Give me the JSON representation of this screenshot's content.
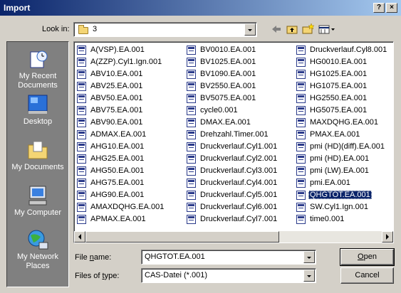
{
  "window": {
    "title": "Import",
    "help_button": "?",
    "close_button": "×"
  },
  "lookin": {
    "label": "Look in:",
    "value": "3"
  },
  "places": [
    {
      "label": "My Recent Documents",
      "icon": "recent-documents-icon"
    },
    {
      "label": "Desktop",
      "icon": "desktop-icon"
    },
    {
      "label": "My Documents",
      "icon": "my-documents-icon"
    },
    {
      "label": "My Computer",
      "icon": "my-computer-icon"
    },
    {
      "label": "My Network Places",
      "icon": "network-places-icon"
    }
  ],
  "files": {
    "col1": [
      "A(VSP).EA.001",
      "A(ZZP).Cyl1.Ign.001",
      "ABV10.EA.001",
      "ABV25.EA.001",
      "ABV50.EA.001",
      "ABV75.EA.001",
      "ABV90.EA.001",
      "ADMAX.EA.001",
      "AHG10.EA.001",
      "AHG25.EA.001",
      "AHG50.EA.001",
      "AHG75.EA.001",
      "AHG90.EA.001",
      "AMAXDQHG.EA.001",
      "APMAX.EA.001"
    ],
    "col2": [
      "BV0010.EA.001",
      "BV1025.EA.001",
      "BV1090.EA.001",
      "BV2550.EA.001",
      "BV5075.EA.001",
      "cycle0.001",
      "DMAX.EA.001",
      "Drehzahl.Timer.001",
      "Druckverlauf.Cyl1.001",
      "Druckverlauf.Cyl2.001",
      "Druckverlauf.Cyl3.001",
      "Druckverlauf.Cyl4.001",
      "Druckverlauf.Cyl5.001",
      "Druckverlauf.Cyl6.001",
      "Druckverlauf.Cyl7.001"
    ],
    "col3": [
      "Druckverlauf.Cyl8.001",
      "HG0010.EA.001",
      "HG1025.EA.001",
      "HG1075.EA.001",
      "HG2550.EA.001",
      "HG5075.EA.001",
      "MAXDQHG.EA.001",
      "PMAX.EA.001",
      "pmi (HD)(diff).EA.001",
      "pmi (HD).EA.001",
      "pmi (LW).EA.001",
      "pmi.EA.001",
      "QHGTOT.EA.001",
      "SW.Cyl1.Ign.001",
      "time0.001"
    ],
    "selected": "QHGTOT.EA.001"
  },
  "form": {
    "filename_label_pre": "File ",
    "filename_label_ul": "n",
    "filename_label_post": "ame:",
    "filename_value": "QHGTOT.EA.001",
    "filetype_label_pre": "Files of ",
    "filetype_label_ul": "t",
    "filetype_label_post": "ype:",
    "filetype_value": "CAS-Datei (*.001)"
  },
  "buttons": {
    "open_ul": "O",
    "open_rest": "pen",
    "cancel": "Cancel"
  },
  "colors": {
    "titlebar_start": "#0a246a",
    "titlebar_end": "#a6caf0",
    "selection": "#0a246a",
    "sidebar": "#808080"
  }
}
